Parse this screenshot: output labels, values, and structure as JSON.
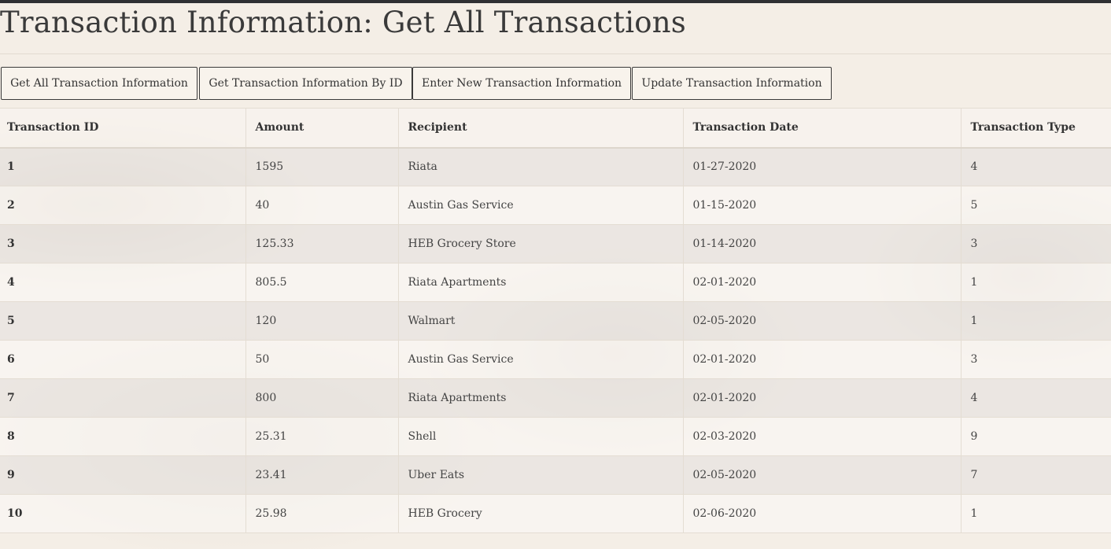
{
  "page": {
    "title": "Transaction Information: Get All Transactions"
  },
  "tabs": [
    {
      "label": "Get All Transaction Information"
    },
    {
      "label": "Get Transaction Information By ID"
    },
    {
      "label": "Enter New Transaction Information"
    },
    {
      "label": "Update Transaction Information"
    }
  ],
  "table": {
    "headers": [
      "Transaction ID",
      "Amount",
      "Recipient",
      "Transaction Date",
      "Transaction Type"
    ],
    "rows": [
      [
        "1",
        "1595",
        "Riata",
        "01-27-2020",
        "4"
      ],
      [
        "2",
        "40",
        "Austin Gas Service",
        "01-15-2020",
        "5"
      ],
      [
        "3",
        "125.33",
        "HEB Grocery Store",
        "01-14-2020",
        "3"
      ],
      [
        "4",
        "805.5",
        "Riata Apartments",
        "02-01-2020",
        "1"
      ],
      [
        "5",
        "120",
        "Walmart",
        "02-05-2020",
        "1"
      ],
      [
        "6",
        "50",
        "Austin Gas Service",
        "02-01-2020",
        "3"
      ],
      [
        "7",
        "800",
        "Riata Apartments",
        "02-01-2020",
        "4"
      ],
      [
        "8",
        "25.31",
        "Shell",
        "02-03-2020",
        "9"
      ],
      [
        "9",
        "23.41",
        "Uber Eats",
        "02-05-2020",
        "7"
      ],
      [
        "10",
        "25.98",
        "HEB Grocery",
        "02-06-2020",
        "1"
      ]
    ]
  },
  "colors": {
    "top_bar": "#2f3033",
    "background": "#f4eee6",
    "text": "#333333"
  }
}
